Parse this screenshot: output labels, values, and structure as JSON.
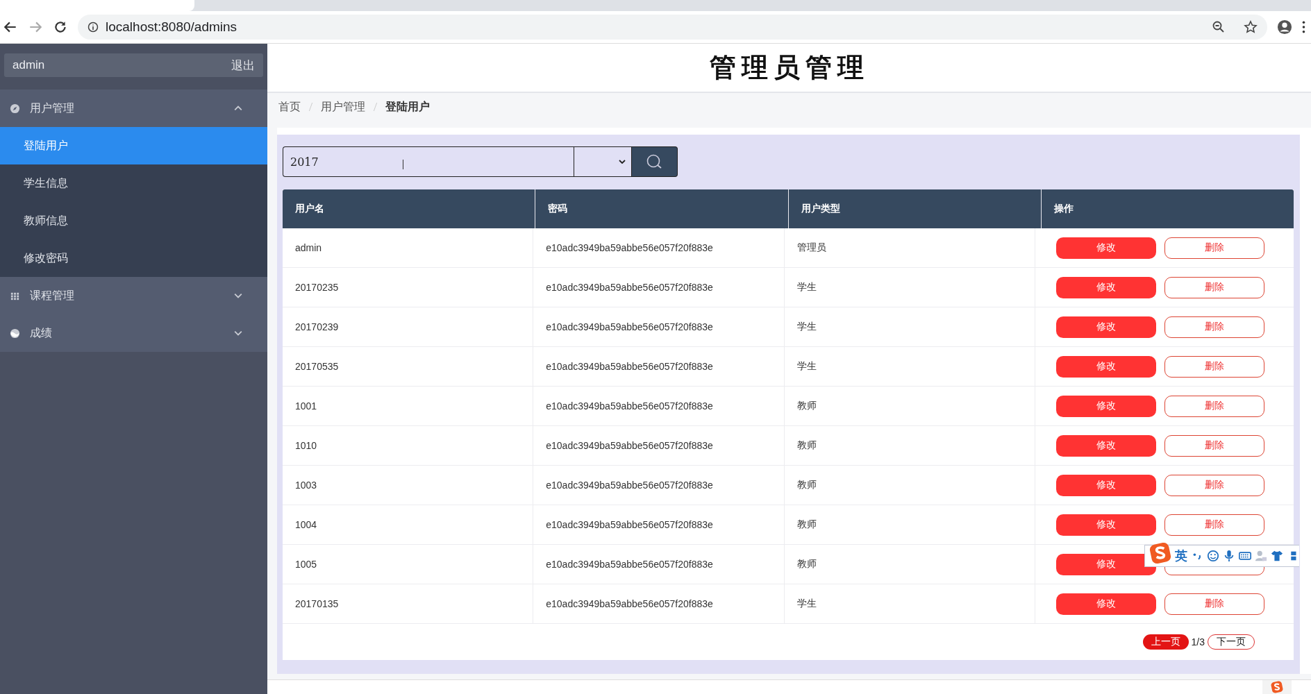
{
  "browser": {
    "url": "localhost:8080/admins"
  },
  "sidebar": {
    "user": "admin",
    "logout": "退出",
    "groups": [
      {
        "label": "用户管理",
        "expanded": true,
        "items": [
          {
            "label": "登陆用户",
            "selected": true
          },
          {
            "label": "学生信息",
            "selected": false
          },
          {
            "label": "教师信息",
            "selected": false
          },
          {
            "label": "修改密码",
            "selected": false
          }
        ]
      },
      {
        "label": "课程管理",
        "expanded": false
      },
      {
        "label": "成绩",
        "expanded": false
      }
    ]
  },
  "header": {
    "title": "管理员管理"
  },
  "breadcrumb": [
    {
      "label": "首页",
      "current": false
    },
    {
      "label": "用户管理",
      "current": false
    },
    {
      "label": "登陆用户",
      "current": true
    }
  ],
  "search": {
    "value": "2017"
  },
  "table": {
    "columns": [
      "用户名",
      "密码",
      "用户类型",
      "操作"
    ],
    "rows": [
      {
        "cells": [
          "admin",
          "e10adc3949ba59abbe56e057f20f883e",
          "管理员"
        ],
        "edit": "修改",
        "delete": "删除"
      },
      {
        "cells": [
          "20170235",
          "e10adc3949ba59abbe56e057f20f883e",
          "学生"
        ],
        "edit": "修改",
        "delete": "删除"
      },
      {
        "cells": [
          "20170239",
          "e10adc3949ba59abbe56e057f20f883e",
          "学生"
        ],
        "edit": "修改",
        "delete": "删除"
      },
      {
        "cells": [
          "20170535",
          "e10adc3949ba59abbe56e057f20f883e",
          "学生"
        ],
        "edit": "修改",
        "delete": "删除"
      },
      {
        "cells": [
          "1001",
          "e10adc3949ba59abbe56e057f20f883e",
          "教师"
        ],
        "edit": "修改",
        "delete": "删除"
      },
      {
        "cells": [
          "1010",
          "e10adc3949ba59abbe56e057f20f883e",
          "教师"
        ],
        "edit": "修改",
        "delete": "删除"
      },
      {
        "cells": [
          "1003",
          "e10adc3949ba59abbe56e057f20f883e",
          "教师"
        ],
        "edit": "修改",
        "delete": "删除"
      },
      {
        "cells": [
          "1004",
          "e10adc3949ba59abbe56e057f20f883e",
          "教师"
        ],
        "edit": "修改",
        "delete": "删除"
      },
      {
        "cells": [
          "1005",
          "e10adc3949ba59abbe56e057f20f883e",
          "教师"
        ],
        "edit": "修改"
      },
      {
        "cells": [
          "20170135",
          "e10adc3949ba59abbe56e057f20f883e",
          "学生"
        ],
        "edit": "修改",
        "delete": "删除"
      }
    ]
  },
  "pagination": {
    "prev": "上一页",
    "page": "1/3",
    "next": "下一页"
  },
  "ime_toolbar": {
    "mode": "英"
  }
}
